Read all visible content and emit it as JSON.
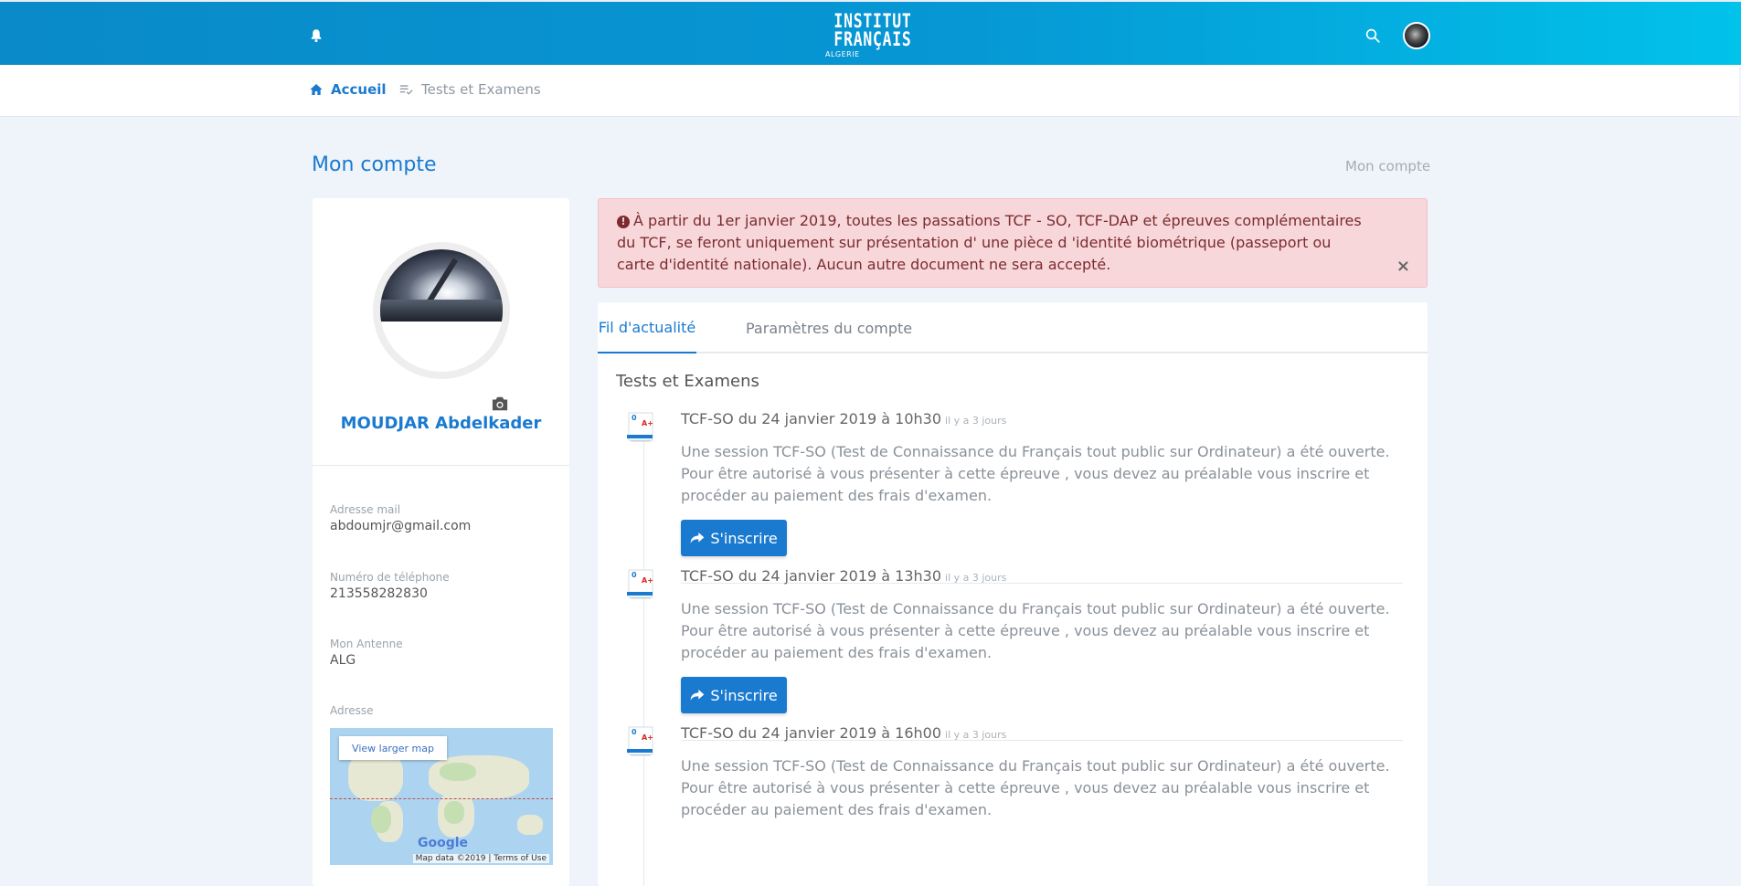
{
  "header": {
    "logo_line1": "INSTITUT",
    "logo_line2": "FRANÇAIS",
    "logo_line3": "ALGERIE",
    "icons": [
      "bell-icon",
      "search-icon",
      "avatar"
    ]
  },
  "nav": {
    "home": "Accueil",
    "tests": "Tests et Examens"
  },
  "page": {
    "title": "Mon compte",
    "breadcrumb": "Mon compte"
  },
  "profile": {
    "name": "MOUDJAR Abdelkader",
    "email_label": "Adresse mail",
    "email": "abdoumjr@gmail.com",
    "phone_label": "Numéro de téléphone",
    "phone": "213558282830",
    "antenne_label": "Mon Antenne",
    "antenne": "ALG",
    "address_label": "Adresse",
    "map_button": "View larger map",
    "map_logo": "Google",
    "map_attribution": "Map data ©2019 | Terms of Use"
  },
  "alert": {
    "text": "À partir du 1er janvier 2019, toutes les passations TCF - SO, TCF-DAP et épreuves complémentaires du TCF, se feront uniquement sur présentation d' une pièce d 'identité biométrique (passeport ou carte d'identité nationale). Aucun autre document ne sera accepté.",
    "close": "×"
  },
  "tabs": [
    "Fil d'actualité",
    "Paramètres du compte"
  ],
  "feed": {
    "section_title": "Tests et Examens",
    "events": [
      {
        "title": "TCF-SO du 24 janvier 2019 à 10h30",
        "time": "il y a 3 jours",
        "desc": "Une session TCF-SO (Test de Connaissance du Français tout public sur Ordinateur) a été ouverte. Pour être autorisé à vous présenter à cette épreuve , vous devez au préalable vous inscrire et procéder au paiement des frais d'examen.",
        "button": "S'inscrire"
      },
      {
        "title": "TCF-SO du 24 janvier 2019 à 13h30",
        "time": "il y a 3 jours",
        "desc": "Une session TCF-SO (Test de Connaissance du Français tout public sur Ordinateur) a été ouverte. Pour être autorisé à vous présenter à cette épreuve , vous devez au préalable vous inscrire et procéder au paiement des frais d'examen.",
        "button": "S'inscrire"
      },
      {
        "title": "TCF-SO du 24 janvier 2019 à 16h00",
        "time": "il y a 3 jours",
        "desc": "Une session TCF-SO (Test de Connaissance du Français tout public sur Ordinateur) a été ouverte. Pour être autorisé à vous présenter à cette épreuve , vous devez au préalable vous inscrire et procéder au paiement des frais d'examen.",
        "button": "S'inscrire"
      }
    ]
  },
  "colors": {
    "brand_blue": "#1a7ad0",
    "header_gradient_start": "#0a8ac8",
    "header_gradient_end": "#01c2ea",
    "alert_bg": "#f8d7da",
    "page_bg": "#eef4f9"
  }
}
